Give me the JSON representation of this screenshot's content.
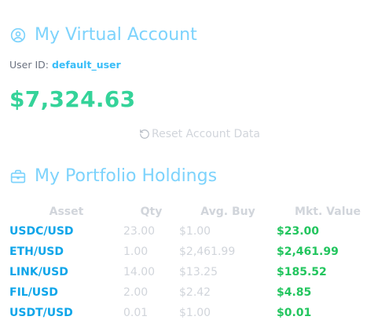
{
  "account": {
    "title": "My Virtual Account",
    "user_id_label": "User ID:",
    "user_id": "default_user",
    "balance": "$7,324.63",
    "reset_label": "Reset Account Data"
  },
  "portfolio": {
    "title": "My Portfolio Holdings",
    "columns": [
      "Asset",
      "Qty",
      "Avg. Buy",
      "Mkt. Value"
    ],
    "rows": [
      {
        "asset": "USDC/USD",
        "qty": "23.00",
        "avg_buy": "$1.00",
        "mkt_value": "$23.00"
      },
      {
        "asset": "ETH/USD",
        "qty": "1.00",
        "avg_buy": "$2,461.99",
        "mkt_value": "$2,461.99"
      },
      {
        "asset": "LINK/USD",
        "qty": "14.00",
        "avg_buy": "$13.25",
        "mkt_value": "$185.52"
      },
      {
        "asset": "FIL/USD",
        "qty": "2.00",
        "avg_buy": "$2.42",
        "mkt_value": "$4.85"
      },
      {
        "asset": "USDT/USD",
        "qty": "0.01",
        "avg_buy": "$1.00",
        "mkt_value": "$0.01"
      }
    ]
  },
  "icons": {
    "account": "user-circle-icon",
    "portfolio": "briefcase-icon",
    "reset": "rotate-ccw-icon"
  },
  "colors": {
    "title": "#7dd3fc",
    "balance": "#34d399",
    "asset": "#0ea5e9",
    "value": "#22c55e",
    "muted": "#d1d5db"
  }
}
